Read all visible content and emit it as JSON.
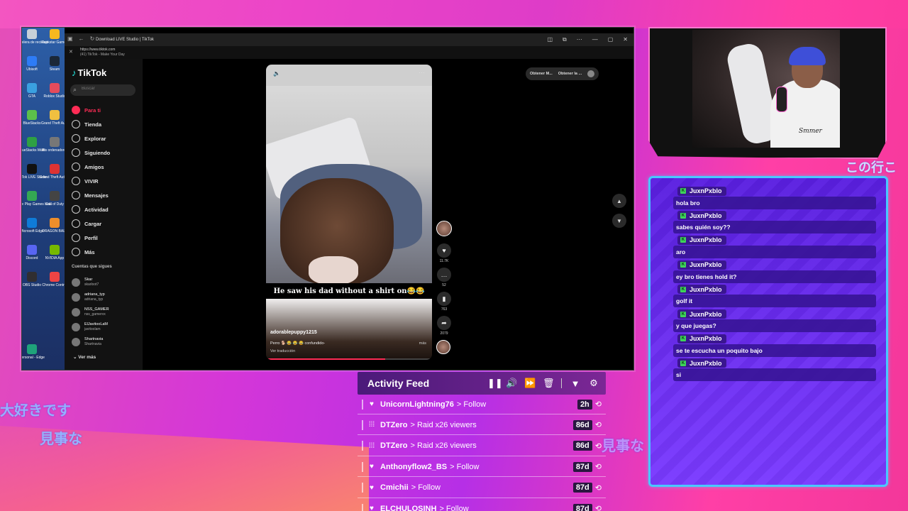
{
  "overlay": {
    "jp_text_1": "大好きです",
    "jp_text_2": "見事な",
    "jp_text_3": "見事な",
    "jp_text_4": "この行こ"
  },
  "desktop_icons": [
    {
      "label": "Papelera de reciclaje",
      "color": "#c7d0d8"
    },
    {
      "label": "Rockstar Games",
      "color": "#f5b81f"
    },
    {
      "label": "Ubisoft",
      "color": "#2e7cf6"
    },
    {
      "label": "Steam",
      "color": "#1b2838"
    },
    {
      "label": "GTA",
      "color": "#3aa0e0"
    },
    {
      "label": "Roblox Studio",
      "color": "#e34b5c"
    },
    {
      "label": "BlueStacks",
      "color": "#5cc04a"
    },
    {
      "label": "Grand Theft Auto",
      "color": "#f0c040"
    },
    {
      "label": "BlueStacks Multi",
      "color": "#2ea043"
    },
    {
      "label": "Mis ordenadores",
      "color": "#777"
    },
    {
      "label": "TikTok LIVE Studio",
      "color": "#111"
    },
    {
      "label": "Grand Theft Auto V",
      "color": "#d33"
    },
    {
      "label": "Google Play Games beta",
      "color": "#34a853"
    },
    {
      "label": "Call of Duty",
      "color": "#444"
    },
    {
      "label": "Microsoft Edge",
      "color": "#0f7bd8"
    },
    {
      "label": "DRAGON BALL",
      "color": "#ee8e2b"
    },
    {
      "label": "Discord",
      "color": "#5865f2"
    },
    {
      "label": "NVIDIA App",
      "color": "#76b900"
    },
    {
      "label": "OBS Studio",
      "color": "#302e31"
    },
    {
      "label": "Chrome Control",
      "color": "#e44"
    },
    {
      "label": "Personal - Edge",
      "color": "#1fa37a"
    }
  ],
  "browser": {
    "tab_title": "Download LIVE Studio | TikTok",
    "url": "https://www.tiktok.com",
    "page_title": "(41) TikTok - Make Your Day"
  },
  "tiktok": {
    "logo": "TikTok",
    "search_placeholder": "Buscar",
    "nav": [
      {
        "label": "Para ti",
        "icon": "home-icon",
        "active": true
      },
      {
        "label": "Tienda",
        "icon": "shop-icon"
      },
      {
        "label": "Explorar",
        "icon": "compass-icon"
      },
      {
        "label": "Siguiendo",
        "icon": "following-icon"
      },
      {
        "label": "Amigos",
        "icon": "friends-icon"
      },
      {
        "label": "VIVIR",
        "icon": "live-icon"
      },
      {
        "label": "Mensajes",
        "icon": "messages-icon"
      },
      {
        "label": "Actividad",
        "icon": "activity-icon"
      },
      {
        "label": "Cargar",
        "icon": "upload-icon"
      },
      {
        "label": "Perfil",
        "icon": "profile-icon"
      },
      {
        "label": "Más",
        "icon": "more-icon"
      }
    ],
    "following_header": "Cuentas que sigues",
    "following": [
      {
        "name": "Skar",
        "handle": "skarloot7"
      },
      {
        "name": "adriana_typ",
        "handle": "adriana_typ"
      },
      {
        "name": "NSS_GAMER",
        "handle": "nss_gamervx"
      },
      {
        "name": "ElJavitooLaM",
        "handle": "javitoolam"
      },
      {
        "name": "Shartnavia",
        "handle": "Shartnavia"
      }
    ],
    "see_more": "Ver más",
    "top_buttons": [
      "Obtener M...",
      "Obtener la ..."
    ],
    "video": {
      "caption": "He saw his dad without a shirt on😂😂",
      "username": "adorablepuppy1215",
      "description": "Perro 🐕 😂 😂 😂 confundido-",
      "see_more": "más",
      "translation": "Ver traducción",
      "progress": 0.72
    },
    "actions": [
      {
        "icon": "heart-icon",
        "glyph": "♥",
        "count": "11.7K"
      },
      {
        "icon": "comment-icon",
        "glyph": "…",
        "count": "52"
      },
      {
        "icon": "bookmark-icon",
        "glyph": "▮",
        "count": "763"
      },
      {
        "icon": "share-icon",
        "glyph": "➦",
        "count": "2079"
      }
    ]
  },
  "chat": {
    "messages": [
      {
        "user": "JuxnPxblo",
        "text": "hola bro"
      },
      {
        "user": "JuxnPxblo",
        "text": "sabes quién soy??"
      },
      {
        "user": "JuxnPxblo",
        "text": "aro"
      },
      {
        "user": "JuxnPxblo",
        "text": "ey bro tienes hold it?"
      },
      {
        "user": "JuxnPxblo",
        "text": "golf it"
      },
      {
        "user": "JuxnPxblo",
        "text": "y que juegas?"
      },
      {
        "user": "JuxnPxblo",
        "text": "se te escucha un poquito bajo"
      },
      {
        "user": "JuxnPxblo",
        "text": "si"
      }
    ],
    "badge_glyph": "K"
  },
  "webcam": {
    "shirt_text": "Smmer"
  },
  "activity_feed": {
    "title": "Activity Feed",
    "controls": [
      {
        "name": "pause-button",
        "glyph": "❚❚"
      },
      {
        "name": "volume-button",
        "glyph": "🔊"
      },
      {
        "name": "skip-button",
        "glyph": "⏩"
      },
      {
        "name": "delete-button",
        "glyph": "🗑"
      },
      {
        "name": "filter-button",
        "glyph": "▼"
      },
      {
        "name": "settings-button",
        "glyph": "⚙"
      }
    ],
    "rows": [
      {
        "type": "follow",
        "glyph": "♥",
        "user": "UnicornLightning76",
        "action": "> Follow",
        "time": "2h"
      },
      {
        "type": "raid",
        "glyph": "⁞⁞⁞",
        "user": "DTZero",
        "action": "> Raid x26 viewers",
        "time": "86d"
      },
      {
        "type": "raid",
        "glyph": "⁞⁞⁞",
        "user": "DTZero",
        "action": "> Raid x26 viewers",
        "time": "86d"
      },
      {
        "type": "follow",
        "glyph": "♥",
        "user": "Anthonyflow2_BS",
        "action": "> Follow",
        "time": "87d"
      },
      {
        "type": "follow",
        "glyph": "♥",
        "user": "Cmichii",
        "action": "> Follow",
        "time": "87d"
      },
      {
        "type": "follow",
        "glyph": "♥",
        "user": "ELCHULOSINH",
        "action": "> Follow",
        "time": "87d"
      }
    ],
    "replay_glyph": "⟲"
  }
}
